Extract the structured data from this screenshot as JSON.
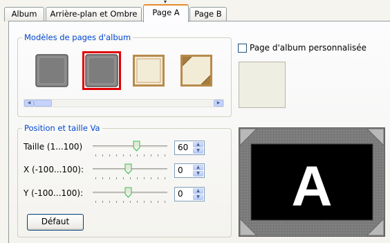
{
  "tabs": [
    {
      "label": "Album",
      "active": false
    },
    {
      "label": "Arrière-plan et Ombre",
      "active": false
    },
    {
      "label": "Page A",
      "active": true
    },
    {
      "label": "Page B",
      "active": false
    }
  ],
  "templates_group": {
    "title": "Modèles de pages d'album",
    "selected_index": 1
  },
  "custom_page": {
    "label": "Page d'album personnalisée",
    "checked": false
  },
  "position_group": {
    "title": "Position et taille Va",
    "rows": [
      {
        "label": "Taille (1...100)",
        "value": "60",
        "slider_fraction": 0.6
      },
      {
        "label": "X (-100...100):",
        "value": "0",
        "slider_fraction": 0.5
      },
      {
        "label": "Y (-100...100):",
        "value": "0",
        "slider_fraction": 0.5
      }
    ],
    "default_button": "Défaut"
  },
  "preview": {
    "letter": "A"
  }
}
